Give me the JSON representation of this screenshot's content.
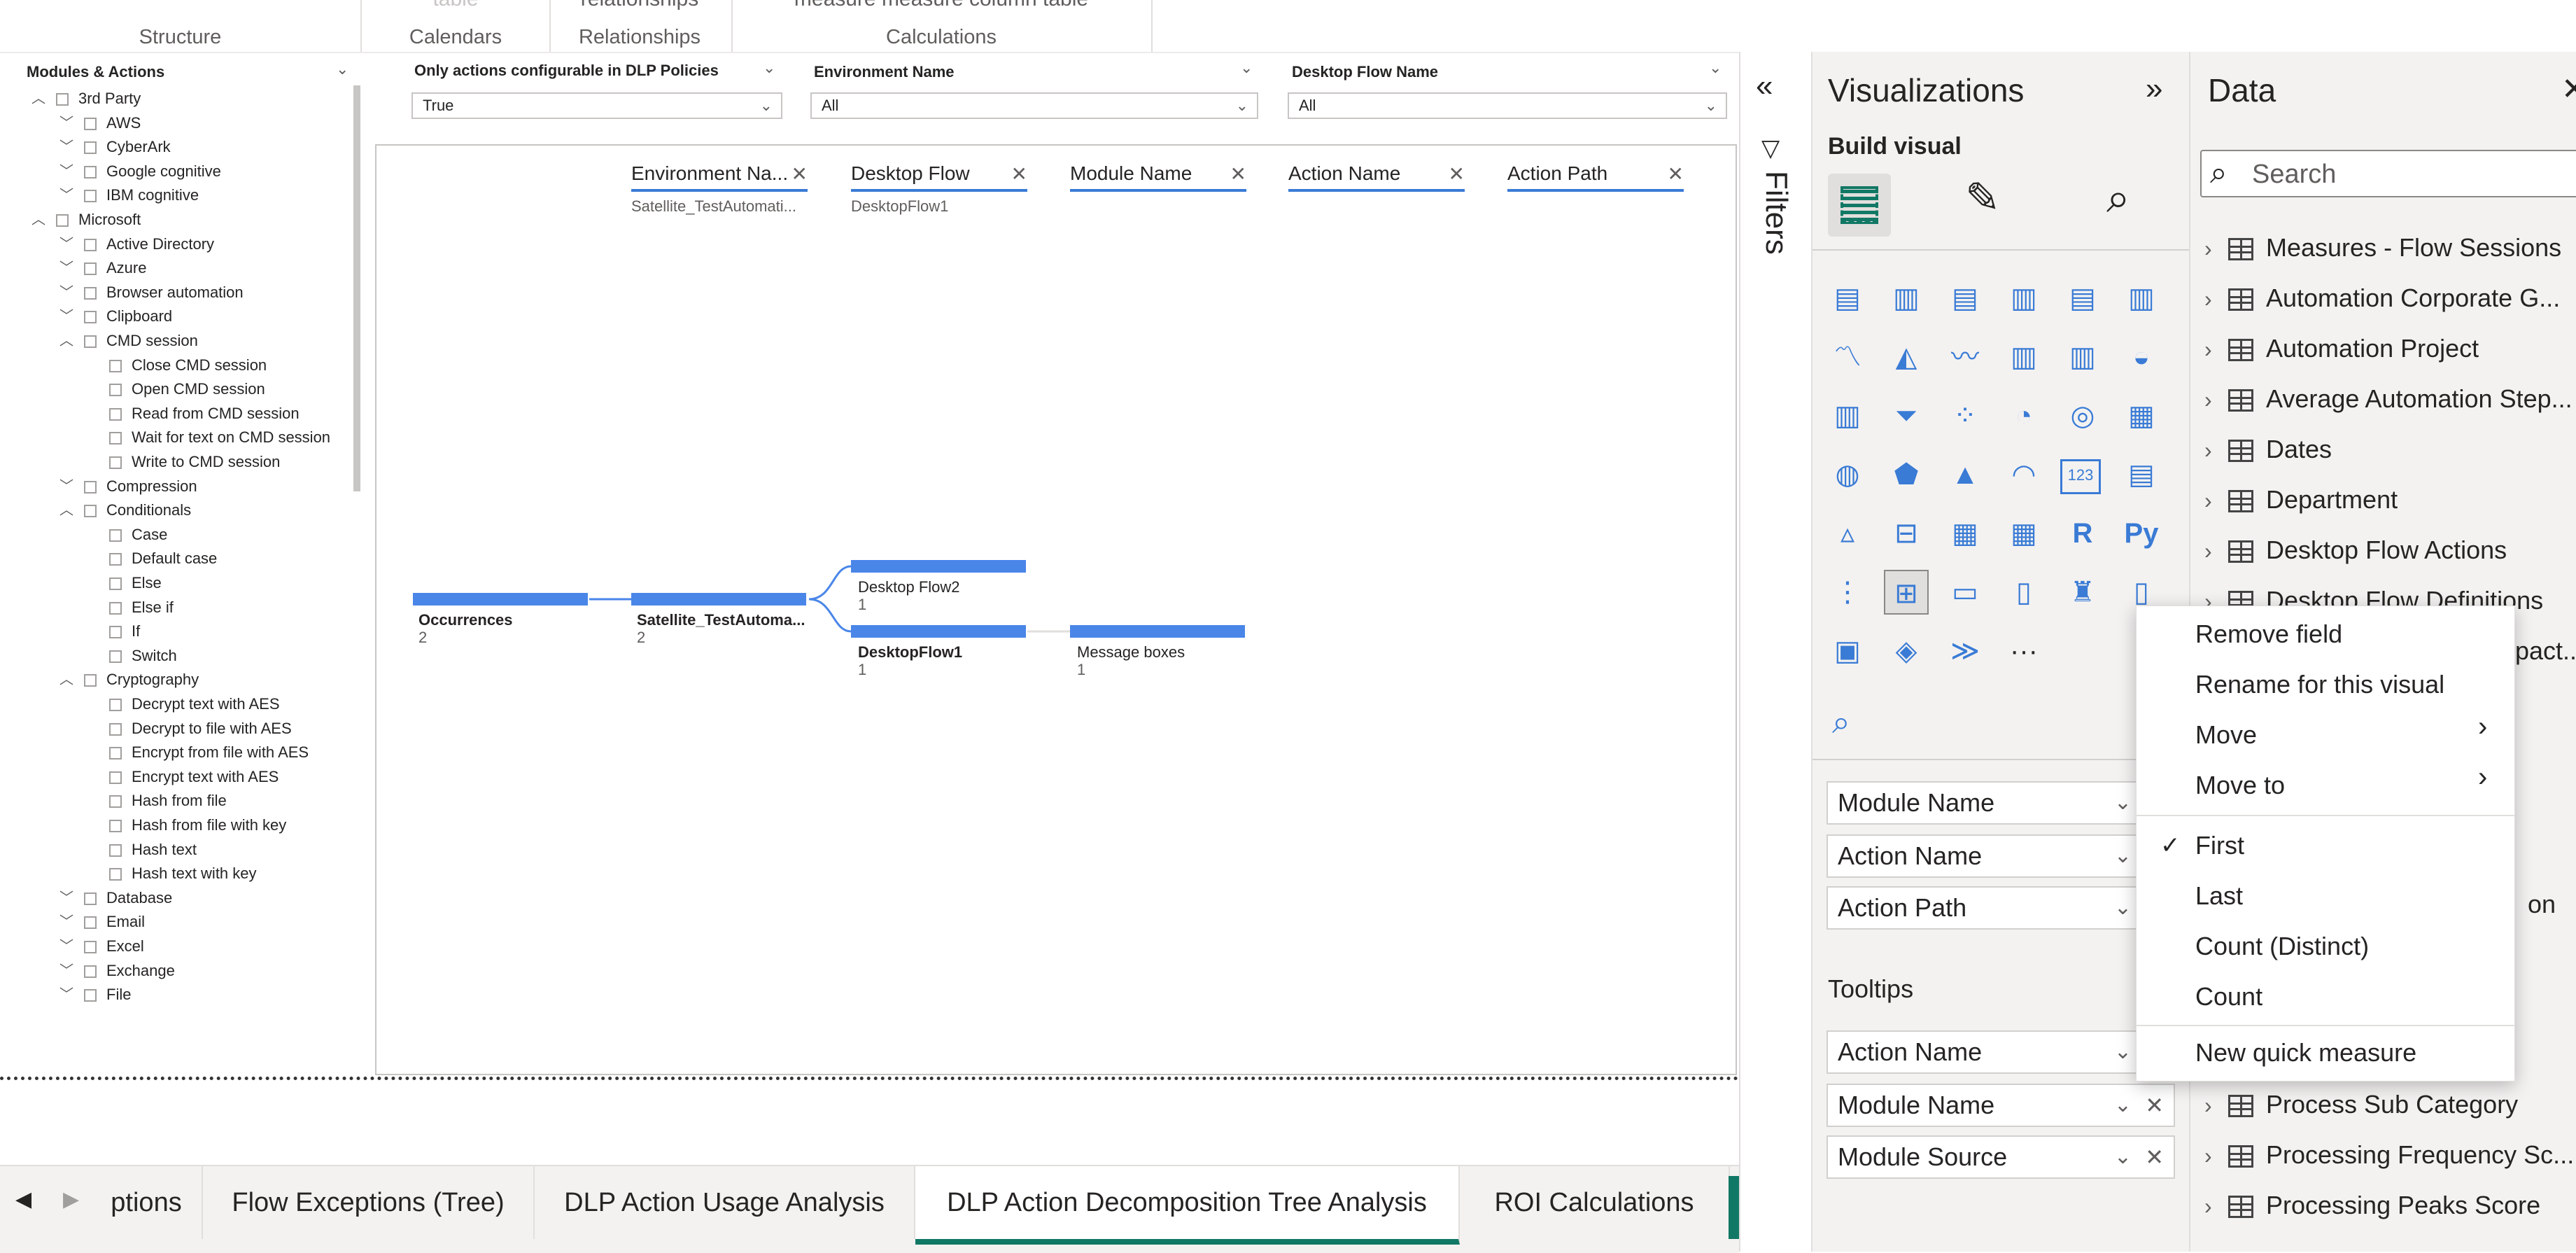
{
  "ribbon": {
    "groups": [
      {
        "label": "Structure"
      },
      {
        "label": "Calendars",
        "top": "table"
      },
      {
        "label": "Relationships",
        "top": "relationships"
      },
      {
        "label": "Calculations",
        "top": "measure measure column  table"
      }
    ]
  },
  "slicer": {
    "title": "Modules & Actions",
    "items": [
      {
        "label": "3rd Party",
        "level": 0,
        "expanded": true
      },
      {
        "label": "AWS",
        "level": 1,
        "expanded": false
      },
      {
        "label": "CyberArk",
        "level": 1,
        "expanded": false
      },
      {
        "label": "Google cognitive",
        "level": 1,
        "expanded": false
      },
      {
        "label": "IBM cognitive",
        "level": 1,
        "expanded": false
      },
      {
        "label": "Microsoft",
        "level": 0,
        "expanded": true
      },
      {
        "label": "Active Directory",
        "level": 1,
        "expanded": false
      },
      {
        "label": "Azure",
        "level": 1,
        "expanded": false
      },
      {
        "label": "Browser automation",
        "level": 1,
        "expanded": false
      },
      {
        "label": "Clipboard",
        "level": 1,
        "expanded": false
      },
      {
        "label": "CMD session",
        "level": 1,
        "expanded": true
      },
      {
        "label": "Close CMD session",
        "level": 2
      },
      {
        "label": "Open CMD session",
        "level": 2
      },
      {
        "label": "Read from CMD session",
        "level": 2
      },
      {
        "label": "Wait for text on CMD session",
        "level": 2
      },
      {
        "label": "Write to CMD session",
        "level": 2
      },
      {
        "label": "Compression",
        "level": 1,
        "expanded": false
      },
      {
        "label": "Conditionals",
        "level": 1,
        "expanded": true
      },
      {
        "label": "Case",
        "level": 2
      },
      {
        "label": "Default case",
        "level": 2
      },
      {
        "label": "Else",
        "level": 2
      },
      {
        "label": "Else if",
        "level": 2
      },
      {
        "label": "If",
        "level": 2
      },
      {
        "label": "Switch",
        "level": 2
      },
      {
        "label": "Cryptography",
        "level": 1,
        "expanded": true
      },
      {
        "label": "Decrypt text with AES",
        "level": 2
      },
      {
        "label": "Decrypt to file with AES",
        "level": 2
      },
      {
        "label": "Encrypt from file with AES",
        "level": 2
      },
      {
        "label": "Encrypt text with AES",
        "level": 2
      },
      {
        "label": "Hash from file",
        "level": 2
      },
      {
        "label": "Hash from file with key",
        "level": 2
      },
      {
        "label": "Hash text",
        "level": 2
      },
      {
        "label": "Hash text with key",
        "level": 2
      },
      {
        "label": "Database",
        "level": 1,
        "expanded": false
      },
      {
        "label": "Email",
        "level": 1,
        "expanded": false
      },
      {
        "label": "Excel",
        "level": 1,
        "expanded": false
      },
      {
        "label": "Exchange",
        "level": 1,
        "expanded": false
      },
      {
        "label": "File",
        "level": 1,
        "expanded": false
      }
    ]
  },
  "filters_top": {
    "dlp": {
      "title": "Only actions configurable in DLP Policies",
      "value": "True"
    },
    "env": {
      "title": "Environment Name",
      "value": "All"
    },
    "flow": {
      "title": "Desktop Flow Name",
      "value": "All"
    }
  },
  "tree": {
    "headers": [
      {
        "label": "Environment Na...",
        "sub": "Satellite_TestAutomati..."
      },
      {
        "label": "Desktop Flow",
        "sub": "DesktopFlow1"
      },
      {
        "label": "Module Name",
        "sub": ""
      },
      {
        "label": "Action Name",
        "sub": ""
      },
      {
        "label": "Action Path",
        "sub": ""
      }
    ],
    "nodes": {
      "root": {
        "label": "Occurrences",
        "value": "2"
      },
      "env": {
        "label": "Satellite_TestAutoma...",
        "value": "2"
      },
      "flow2": {
        "label": "Desktop Flow2",
        "value": "1"
      },
      "flow1": {
        "label": "DesktopFlow1",
        "value": "1"
      },
      "module": {
        "label": "Message boxes",
        "value": "1"
      }
    },
    "bar_fraction": {
      "root": 1.0,
      "env": 1.0,
      "flow2": 1.0,
      "flow1": 1.0,
      "module": 1.0
    }
  },
  "tabs": [
    {
      "label": "ptions"
    },
    {
      "label": "Flow Exceptions (Tree)"
    },
    {
      "label": "DLP Action Usage Analysis"
    },
    {
      "label": "DLP Action Decomposition Tree Analysis",
      "active": true
    },
    {
      "label": "ROI Calculations"
    }
  ],
  "add_tab": "+",
  "filters_pane": {
    "label": "Filters"
  },
  "viz": {
    "title": "Visualizations",
    "build_visual": "Build visual",
    "more": "···",
    "wells": [
      "Module Name",
      "Action Name",
      "Action Path"
    ],
    "tooltips_label": "Tooltips",
    "tooltip_wells": [
      "Action Name",
      "Module Name",
      "Module Source"
    ],
    "r_label": "R",
    "py_label": "Py",
    "num_label": "123"
  },
  "data": {
    "title": "Data",
    "search_placeholder": "Search",
    "tables": [
      "Measures - Flow Sessions",
      "Automation Corporate G...",
      "Automation Project",
      "Average Automation Step...",
      "Dates",
      "Department",
      "Desktop Flow Actions",
      "Desktop Flow Definitions",
      "pact..",
      "on",
      "Process Sub Category",
      "Processing Frequency Sc...",
      "Processing Peaks Score"
    ]
  },
  "context_menu": {
    "items": [
      "Remove field",
      "Rename for this visual",
      "Move",
      "Move to",
      "First",
      "Last",
      "Count (Distinct)",
      "Count",
      "New quick measure"
    ],
    "checked": "First"
  },
  "colors": {
    "accent_bar": "#4a86e8",
    "active_tab": "#117865",
    "add_tab_bg": "#117865"
  }
}
